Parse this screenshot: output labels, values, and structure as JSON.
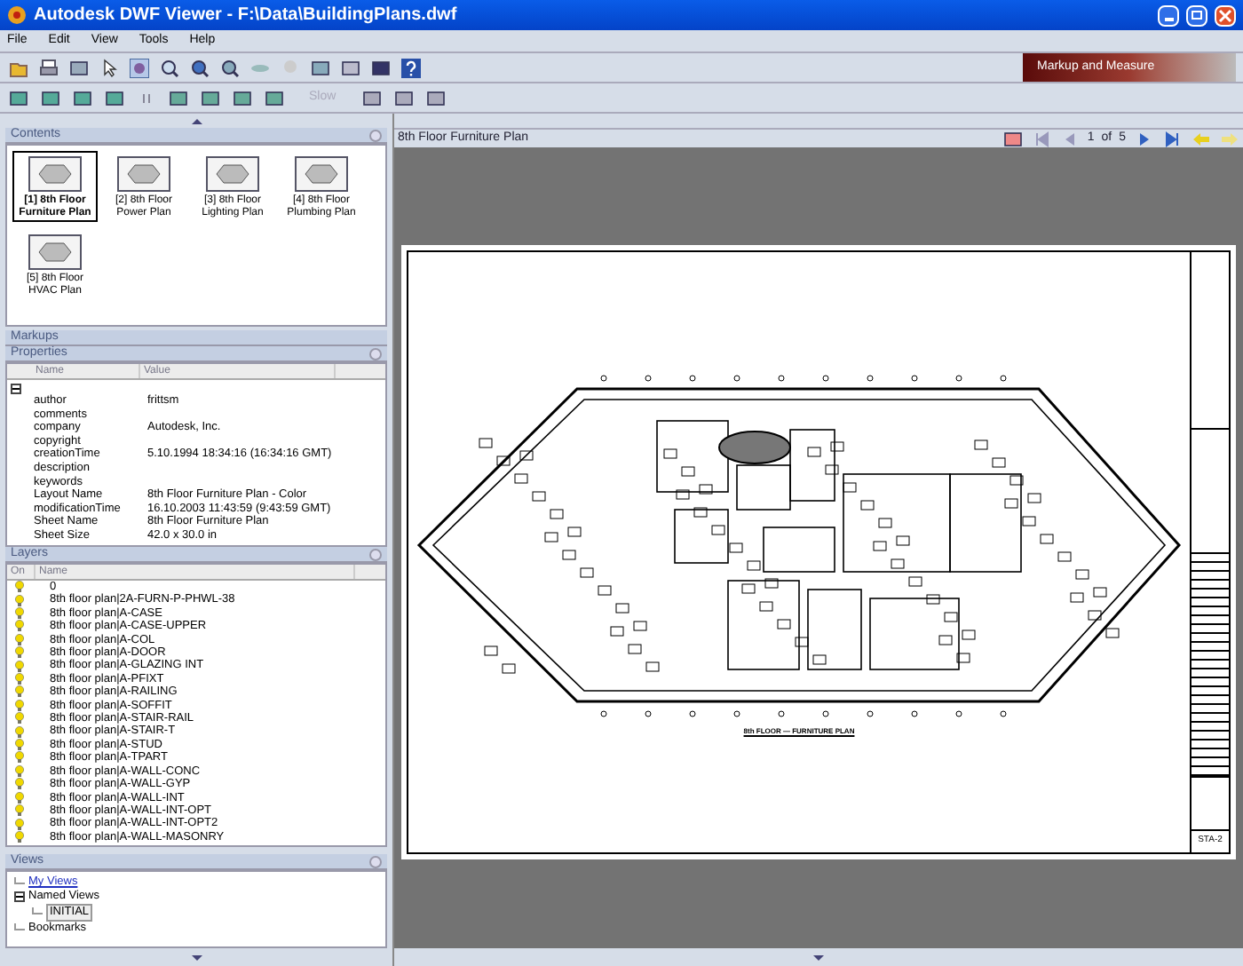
{
  "window": {
    "title": "Autodesk DWF Viewer - F:\\Data\\BuildingPlans.dwf"
  },
  "menu": [
    {
      "label": "File"
    },
    {
      "label": "Edit"
    },
    {
      "label": "View"
    },
    {
      "label": "Tools"
    },
    {
      "label": "Help"
    }
  ],
  "toolbar": {
    "speed": "Slow",
    "banner": "Markup and Measure"
  },
  "contents": {
    "title": "Contents",
    "sheets": [
      {
        "label": "[1] 8th Floor Furniture Plan",
        "selected": true
      },
      {
        "label": "[2] 8th Floor Power Plan",
        "selected": false
      },
      {
        "label": "[3] 8th Floor Lighting Plan",
        "selected": false
      },
      {
        "label": "[4] 8th Floor Plumbing Plan",
        "selected": false
      },
      {
        "label": "[5] 8th Floor HVAC Plan",
        "selected": false
      }
    ]
  },
  "markups": {
    "title": "Markups"
  },
  "properties": {
    "title": "Properties",
    "columns": [
      "Name",
      "Value"
    ],
    "expanded": true,
    "rows": [
      {
        "name": "author",
        "value": "frittsm"
      },
      {
        "name": "comments"
      },
      {
        "name": "company",
        "value": "Autodesk, Inc."
      },
      {
        "name": "copyright"
      },
      {
        "name": "creationTime",
        "value": "5.10.1994  18:34:16  (16:34:16 GMT)"
      },
      {
        "name": "description"
      },
      {
        "name": "keywords"
      },
      {
        "name": "Layout Name",
        "value": "8th Floor Furniture Plan - Color"
      },
      {
        "name": "modificationTime",
        "value": "16.10.2003  11:43:59  (9:43:59 GMT)"
      },
      {
        "name": "Sheet Name",
        "value": "8th Floor Furniture Plan"
      },
      {
        "name": "Sheet Size",
        "value": "42.0 x 30.0 in"
      }
    ]
  },
  "layers": {
    "title": "Layers",
    "columns": [
      "On",
      "Name"
    ],
    "rows": [
      {
        "name": "0",
        "on": true
      },
      {
        "name": "8th floor plan|2A-FURN-P-PHWL-38",
        "on": true
      },
      {
        "name": "8th floor plan|A-CASE",
        "on": true
      },
      {
        "name": "8th floor plan|A-CASE-UPPER",
        "on": true
      },
      {
        "name": "8th floor plan|A-COL",
        "on": true
      },
      {
        "name": "8th floor plan|A-DOOR",
        "on": true
      },
      {
        "name": "8th floor plan|A-GLAZING INT",
        "on": true
      },
      {
        "name": "8th floor plan|A-PFIXT",
        "on": true
      },
      {
        "name": "8th floor plan|A-RAILING",
        "on": true
      },
      {
        "name": "8th floor plan|A-SOFFIT",
        "on": true
      },
      {
        "name": "8th floor plan|A-STAIR-RAIL",
        "on": true
      },
      {
        "name": "8th floor plan|A-STAIR-T",
        "on": true
      },
      {
        "name": "8th floor plan|A-STUD",
        "on": true
      },
      {
        "name": "8th floor plan|A-TPART",
        "on": true
      },
      {
        "name": "8th floor plan|A-WALL-CONC",
        "on": true
      },
      {
        "name": "8th floor plan|A-WALL-GYP",
        "on": true
      },
      {
        "name": "8th floor plan|A-WALL-INT",
        "on": true
      },
      {
        "name": "8th floor plan|A-WALL-INT-OPT",
        "on": true
      },
      {
        "name": "8th floor plan|A-WALL-INT-OPT2",
        "on": true
      },
      {
        "name": "8th floor plan|A-WALL-MASONRY",
        "on": true
      }
    ]
  },
  "views": {
    "title": "Views",
    "items": [
      {
        "label": "My Views",
        "kind": "link",
        "selected": false
      },
      {
        "label": "Named Views",
        "kind": "node",
        "expanded": true,
        "selected": false,
        "children": [
          {
            "label": "INITIAL",
            "kind": "node",
            "selected": true
          }
        ]
      },
      {
        "label": "Bookmarks",
        "kind": "node",
        "selected": false
      }
    ]
  },
  "viewer": {
    "title": "8th Floor Furniture Plan",
    "page": "1",
    "of": "of",
    "total": "5",
    "drawing_title": "8th FLOOR — FURNITURE PLAN",
    "sheet_number": "STA-2"
  }
}
